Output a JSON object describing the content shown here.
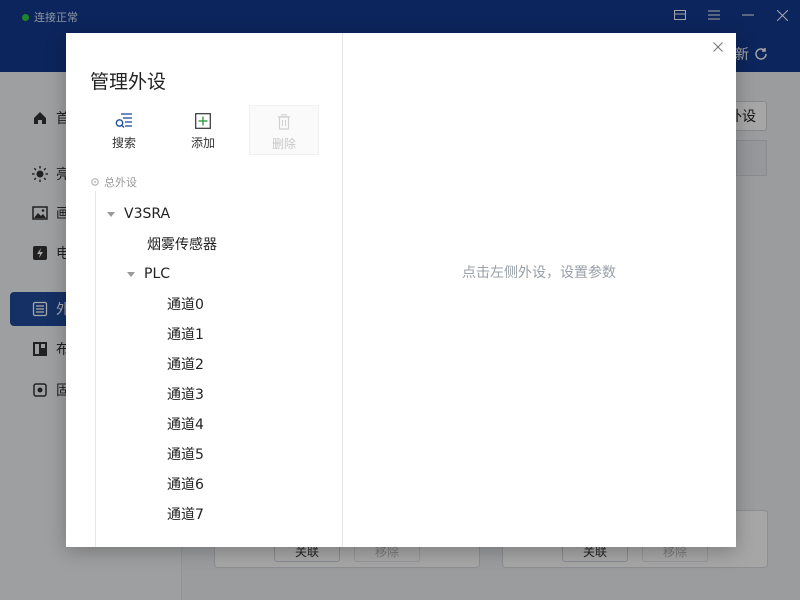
{
  "app": {
    "connection_status": "连接正常",
    "refresh_label": "新",
    "sidebar_items": [
      {
        "label": "首",
        "icon": "home-icon"
      },
      {
        "label": "亮",
        "icon": "brightness-icon"
      },
      {
        "label": "画",
        "icon": "image-icon"
      },
      {
        "label": "电",
        "icon": "power-icon"
      },
      {
        "label": "外",
        "icon": "peripheral-icon",
        "active": true
      },
      {
        "label": "布",
        "icon": "layout-icon"
      },
      {
        "label": "固",
        "icon": "firmware-icon"
      }
    ],
    "right_button_label": "外设",
    "bottom_buttons": [
      {
        "label": "关联",
        "disabled": false
      },
      {
        "label": "移除",
        "disabled": true
      },
      {
        "label": "关联",
        "disabled": false
      },
      {
        "label": "移除",
        "disabled": true
      }
    ]
  },
  "dialog": {
    "title": "管理外设",
    "toolbar": {
      "search_label": "搜索",
      "add_label": "添加",
      "delete_label": "删除"
    },
    "tree": {
      "root_label": "总外设",
      "nodes": [
        {
          "label": "V3SRA",
          "level": 1,
          "expanded": true
        },
        {
          "label": "烟雾传感器",
          "level": 2
        },
        {
          "label": "PLC",
          "level": 2,
          "expanded": true
        },
        {
          "label": "通道0",
          "level": 3
        },
        {
          "label": "通道1",
          "level": 3
        },
        {
          "label": "通道2",
          "level": 3
        },
        {
          "label": "通道3",
          "level": 3
        },
        {
          "label": "通道4",
          "level": 3
        },
        {
          "label": "通道5",
          "level": 3
        },
        {
          "label": "通道6",
          "level": 3
        },
        {
          "label": "通道7",
          "level": 3
        }
      ]
    },
    "placeholder": "点击左侧外设，设置参数"
  },
  "colors": {
    "titlebar": "#133a8e",
    "sidebar_active": "#1f4a9a",
    "status_dot": "#2ecc40"
  }
}
